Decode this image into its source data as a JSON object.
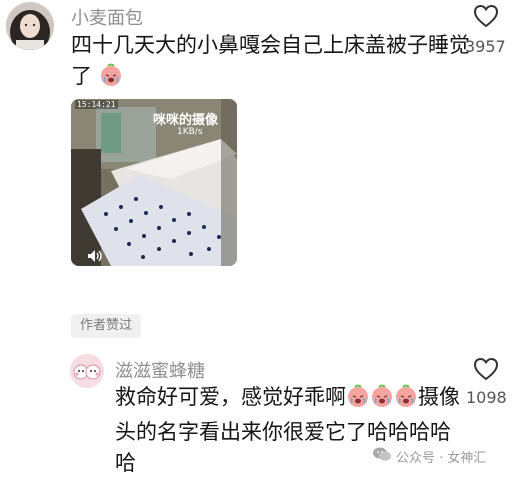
{
  "comment1": {
    "username": "小麦面包",
    "text_line1": "四十几天大的小鼻嘎会自己上床盖被子睡觉",
    "text_line2": "了",
    "likes": "3957",
    "image": {
      "timestamp": "15:14:21",
      "camera_name": "咪咪的摄像",
      "speed": "1KB/s"
    },
    "author_badge": "作者赞过"
  },
  "comment2": {
    "username": "滋滋蜜蜂糖",
    "text_line1a": "救命好可爱，感觉好乖啊",
    "text_line1b": "摄像",
    "text_line2": "头的名字看出来你很爱它了哈哈哈哈",
    "text_line3": "哈",
    "likes": "1098"
  },
  "watermark": {
    "text": "公众号 · 女神汇"
  },
  "icons": {
    "like": "heart-outline-icon",
    "emoji": "crying-face-emoji",
    "sound": "speaker-icon",
    "wechat": "wechat-icon"
  }
}
